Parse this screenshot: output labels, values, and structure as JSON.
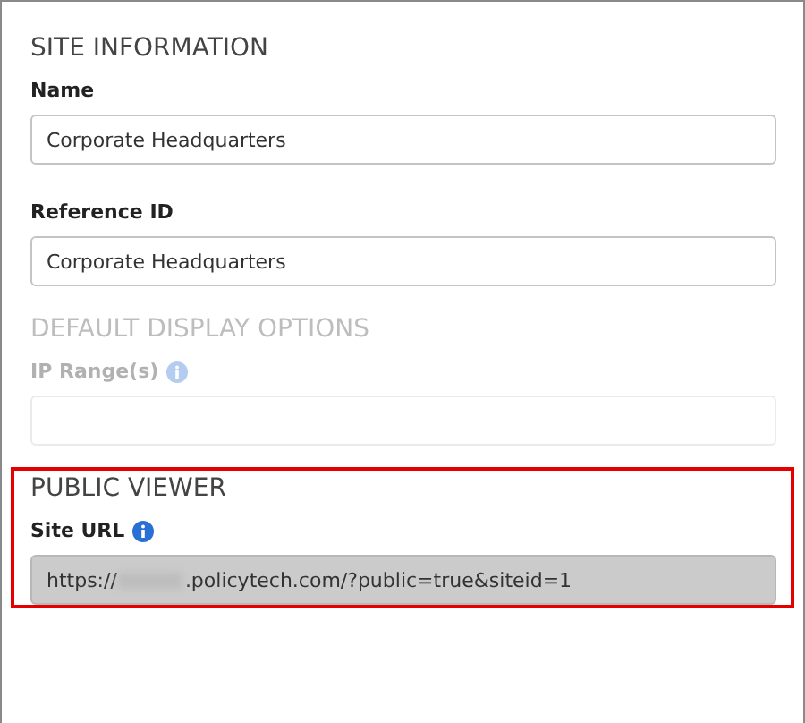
{
  "sections": [
    {
      "title": "SITE INFORMATION",
      "faded": false,
      "highlighted": false,
      "fields": [
        {
          "label": "Name",
          "info": false,
          "readonly": false,
          "value": "Corporate Headquarters"
        },
        {
          "label": "Reference ID",
          "info": false,
          "readonly": false,
          "value": "Corporate Headquarters"
        }
      ]
    },
    {
      "title": "DEFAULT DISPLAY OPTIONS",
      "faded": true,
      "highlighted": false,
      "fields": [
        {
          "label": "IP Range(s)",
          "info": true,
          "readonly": false
        }
      ]
    },
    {
      "title": "PUBLIC VIEWER",
      "faded": false,
      "highlighted": true,
      "fields": [
        {
          "label": "Site URL",
          "info": true,
          "readonly": true,
          "value_start": "https://",
          "redacted": true,
          "value_end": ".policytech.com/?public=true&siteid=1"
        }
      ]
    }
  ]
}
